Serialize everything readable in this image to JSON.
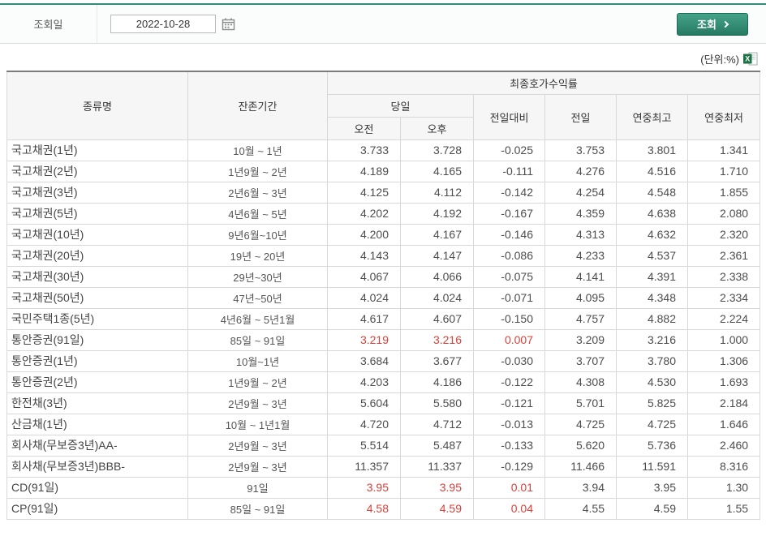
{
  "query_bar": {
    "label": "조회일",
    "date_value": "2022-10-28",
    "search_button_label": "조회"
  },
  "unit_label": "(단위:%)",
  "colors": {
    "accent_teal": "#2f8c75",
    "up_red": "#d6413b"
  },
  "table": {
    "headers": {
      "type": "종류명",
      "maturity": "잔존기간",
      "yield_group": "최종호가수익률",
      "today": "당일",
      "am": "오전",
      "pm": "오후",
      "vs_prev": "전일대비",
      "prev": "전일",
      "year_high": "연중최고",
      "year_low": "연중최저"
    },
    "rows": [
      {
        "name": "국고채권(1년)",
        "period": "10월 ~ 1년",
        "am": "3.733",
        "pm": "3.728",
        "diff": "-0.025",
        "prev": "3.753",
        "high": "3.801",
        "low": "1.341",
        "up": false
      },
      {
        "name": "국고채권(2년)",
        "period": "1년9월 ~ 2년",
        "am": "4.189",
        "pm": "4.165",
        "diff": "-0.111",
        "prev": "4.276",
        "high": "4.516",
        "low": "1.710",
        "up": false
      },
      {
        "name": "국고채권(3년)",
        "period": "2년6월 ~ 3년",
        "am": "4.125",
        "pm": "4.112",
        "diff": "-0.142",
        "prev": "4.254",
        "high": "4.548",
        "low": "1.855",
        "up": false
      },
      {
        "name": "국고채권(5년)",
        "period": "4년6월 ~ 5년",
        "am": "4.202",
        "pm": "4.192",
        "diff": "-0.167",
        "prev": "4.359",
        "high": "4.638",
        "low": "2.080",
        "up": false
      },
      {
        "name": "국고채권(10년)",
        "period": "9년6월~10년",
        "am": "4.200",
        "pm": "4.167",
        "diff": "-0.146",
        "prev": "4.313",
        "high": "4.632",
        "low": "2.320",
        "up": false
      },
      {
        "name": "국고채권(20년)",
        "period": "19년 ~ 20년",
        "am": "4.143",
        "pm": "4.147",
        "diff": "-0.086",
        "prev": "4.233",
        "high": "4.537",
        "low": "2.361",
        "up": false
      },
      {
        "name": "국고채권(30년)",
        "period": "29년~30년",
        "am": "4.067",
        "pm": "4.066",
        "diff": "-0.075",
        "prev": "4.141",
        "high": "4.391",
        "low": "2.338",
        "up": false
      },
      {
        "name": "국고채권(50년)",
        "period": "47년~50년",
        "am": "4.024",
        "pm": "4.024",
        "diff": "-0.071",
        "prev": "4.095",
        "high": "4.348",
        "low": "2.334",
        "up": false
      },
      {
        "name": "국민주택1종(5년)",
        "period": "4년6월 ~ 5년1월",
        "am": "4.617",
        "pm": "4.607",
        "diff": "-0.150",
        "prev": "4.757",
        "high": "4.882",
        "low": "2.224",
        "up": false
      },
      {
        "name": "통안증권(91일)",
        "period": "85일 ~ 91일",
        "am": "3.219",
        "pm": "3.216",
        "diff": "0.007",
        "prev": "3.209",
        "high": "3.216",
        "low": "1.000",
        "up": true
      },
      {
        "name": "통안증권(1년)",
        "period": "10월~1년",
        "am": "3.684",
        "pm": "3.677",
        "diff": "-0.030",
        "prev": "3.707",
        "high": "3.780",
        "low": "1.306",
        "up": false
      },
      {
        "name": "통안증권(2년)",
        "period": "1년9월 ~ 2년",
        "am": "4.203",
        "pm": "4.186",
        "diff": "-0.122",
        "prev": "4.308",
        "high": "4.530",
        "low": "1.693",
        "up": false
      },
      {
        "name": "한전채(3년)",
        "period": "2년9월 ~ 3년",
        "am": "5.604",
        "pm": "5.580",
        "diff": "-0.121",
        "prev": "5.701",
        "high": "5.825",
        "low": "2.184",
        "up": false
      },
      {
        "name": "산금채(1년)",
        "period": "10월 ~ 1년1월",
        "am": "4.720",
        "pm": "4.712",
        "diff": "-0.013",
        "prev": "4.725",
        "high": "4.725",
        "low": "1.646",
        "up": false
      },
      {
        "name": "회사채(무보증3년)AA-",
        "period": "2년9월 ~ 3년",
        "am": "5.514",
        "pm": "5.487",
        "diff": "-0.133",
        "prev": "5.620",
        "high": "5.736",
        "low": "2.460",
        "up": false
      },
      {
        "name": "회사채(무보증3년)BBB-",
        "period": "2년9월 ~ 3년",
        "am": "11.357",
        "pm": "11.337",
        "diff": "-0.129",
        "prev": "11.466",
        "high": "11.591",
        "low": "8.316",
        "up": false
      },
      {
        "name": "CD(91일)",
        "period": "91일",
        "am": "3.95",
        "pm": "3.95",
        "diff": "0.01",
        "prev": "3.94",
        "high": "3.95",
        "low": "1.30",
        "up": true
      },
      {
        "name": "CP(91일)",
        "period": "85일 ~ 91일",
        "am": "4.58",
        "pm": "4.59",
        "diff": "0.04",
        "prev": "4.55",
        "high": "4.59",
        "low": "1.55",
        "up": true
      }
    ]
  }
}
